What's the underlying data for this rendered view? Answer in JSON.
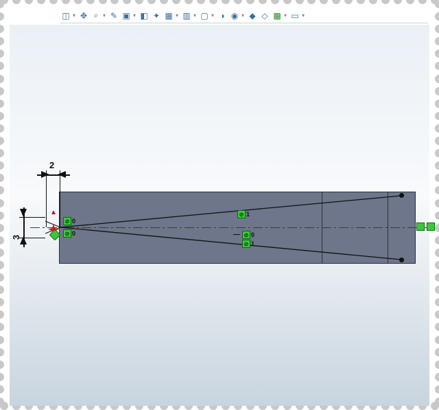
{
  "toolbar": {
    "items": [
      {
        "name": "view-cube-icon",
        "glyph": "◫"
      },
      {
        "name": "view-axis-icon",
        "glyph": "✥"
      },
      {
        "name": "zoom-fit-icon",
        "glyph": "⌕"
      },
      {
        "name": "wand-icon",
        "glyph": "✎"
      },
      {
        "name": "display-style-icon",
        "glyph": "▣"
      },
      {
        "name": "section-icon",
        "glyph": "◧"
      },
      {
        "name": "wrench-icon",
        "glyph": "✦"
      },
      {
        "name": "box-shaded-icon",
        "glyph": "▦"
      },
      {
        "name": "box-edges-icon",
        "glyph": "▥"
      },
      {
        "name": "box-blank-icon",
        "glyph": "▢"
      },
      {
        "name": "perspective-icon",
        "glyph": "◑"
      },
      {
        "name": "hide-show-icon",
        "glyph": "◉"
      },
      {
        "name": "scenes-icon",
        "glyph": "◆"
      },
      {
        "name": "apply-scene-icon",
        "glyph": "◇"
      },
      {
        "name": "render-icon",
        "glyph": "▩"
      },
      {
        "name": "monitor-icon",
        "glyph": "▭"
      }
    ]
  },
  "dimensions": {
    "horizontal": "2",
    "vertical": "3"
  },
  "constraints": {
    "point_a": {
      "symbol": "⊘",
      "index": "0"
    },
    "point_b": {
      "symbol": "⊘",
      "index": "0"
    },
    "upper_dia": {
      "symbol": "⊘",
      "index": "1"
    },
    "lower_dia": {
      "prefix": "—",
      "symbol": "⊘",
      "index": "0",
      "symbol2": "⊘",
      "index2": "1"
    }
  },
  "colors": {
    "body": "#6d768a",
    "accent_green": "#3dc63d",
    "accent_red": "#c62020"
  }
}
